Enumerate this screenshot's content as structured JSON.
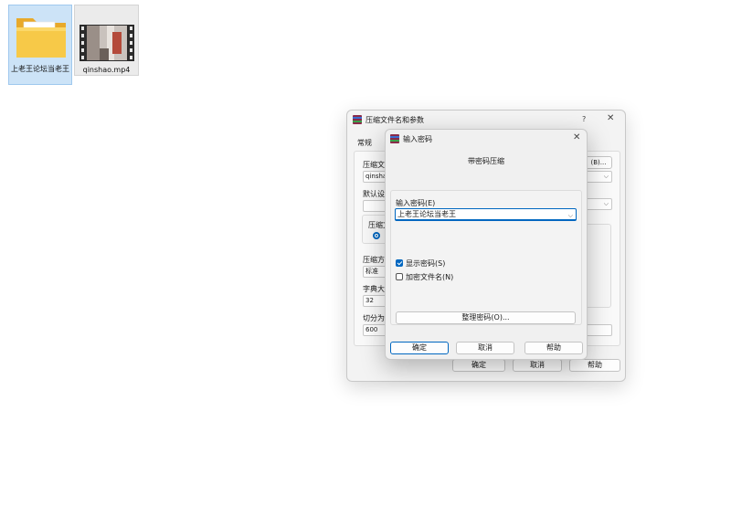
{
  "desktop": {
    "icons": [
      {
        "label": "上老王论坛当老王",
        "icon": "folder-icon"
      },
      {
        "label": "qinshao.mp4",
        "icon": "video-thumbnail-icon"
      }
    ]
  },
  "archive_dialog": {
    "title": "压缩文件名和参数",
    "help_glyph": "?",
    "close_glyph": "✕",
    "tab_general": "常规",
    "archive_name_label": "压缩文",
    "archive_name_value": "qinshao",
    "browse_button": "(B)...",
    "default_profile_label": "默认设",
    "format_group_label": "压缩文",
    "method_label": "压缩方",
    "method_value": "标准",
    "dict_label": "字典大",
    "dict_value": "32",
    "split_label": "切分为",
    "split_value": "600",
    "ok_button": "确定",
    "cancel_button": "取消",
    "help_button": "帮助"
  },
  "password_dialog": {
    "title": "输入密码",
    "close_glyph": "✕",
    "heading": "带密码压缩",
    "password_label": "输入密码(E)",
    "password_value": "上老王论坛当老王",
    "show_password_label": "显示密码(S)",
    "show_password_checked": true,
    "encrypt_names_label": "加密文件名(N)",
    "encrypt_names_checked": false,
    "organize_button": "整理密码(O)...",
    "ok_button": "确定",
    "cancel_button": "取消",
    "help_button": "帮助"
  },
  "colors": {
    "accent": "#0067c0",
    "folder": "#f5c542",
    "selection": "#cce3f7"
  }
}
